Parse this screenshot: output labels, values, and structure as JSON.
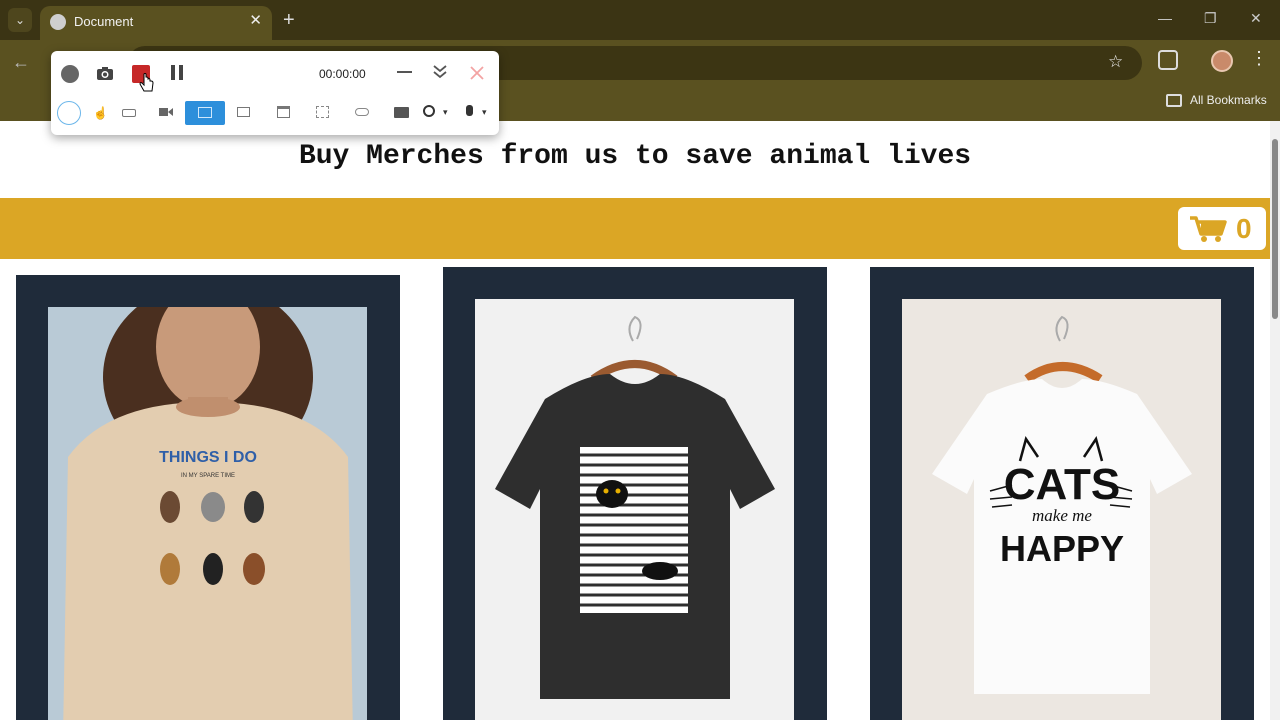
{
  "browser": {
    "tab_title": "Document",
    "tab_close": "✕",
    "new_tab": "+",
    "bookmarks_label": "All Bookmarks"
  },
  "recorder": {
    "timer": "00:00:00"
  },
  "page": {
    "heading": "Buy Merches from us to save animal lives",
    "cart_count": "0"
  },
  "products": [
    {
      "shirt_color": "beige",
      "print_title": "THINGS I DO",
      "print_subtitle": "IN MY SPARE TIME"
    },
    {
      "shirt_color": "black",
      "print_title": "",
      "print_subtitle": ""
    },
    {
      "shirt_color": "white",
      "print_title": "CATS",
      "print_middle": "make me",
      "print_bottom": "HAPPY"
    }
  ],
  "colors": {
    "accent": "#dba625",
    "card_bg": "#1f2b3a",
    "chrome_frame": "#5a5120",
    "record_red": "#c62828"
  }
}
